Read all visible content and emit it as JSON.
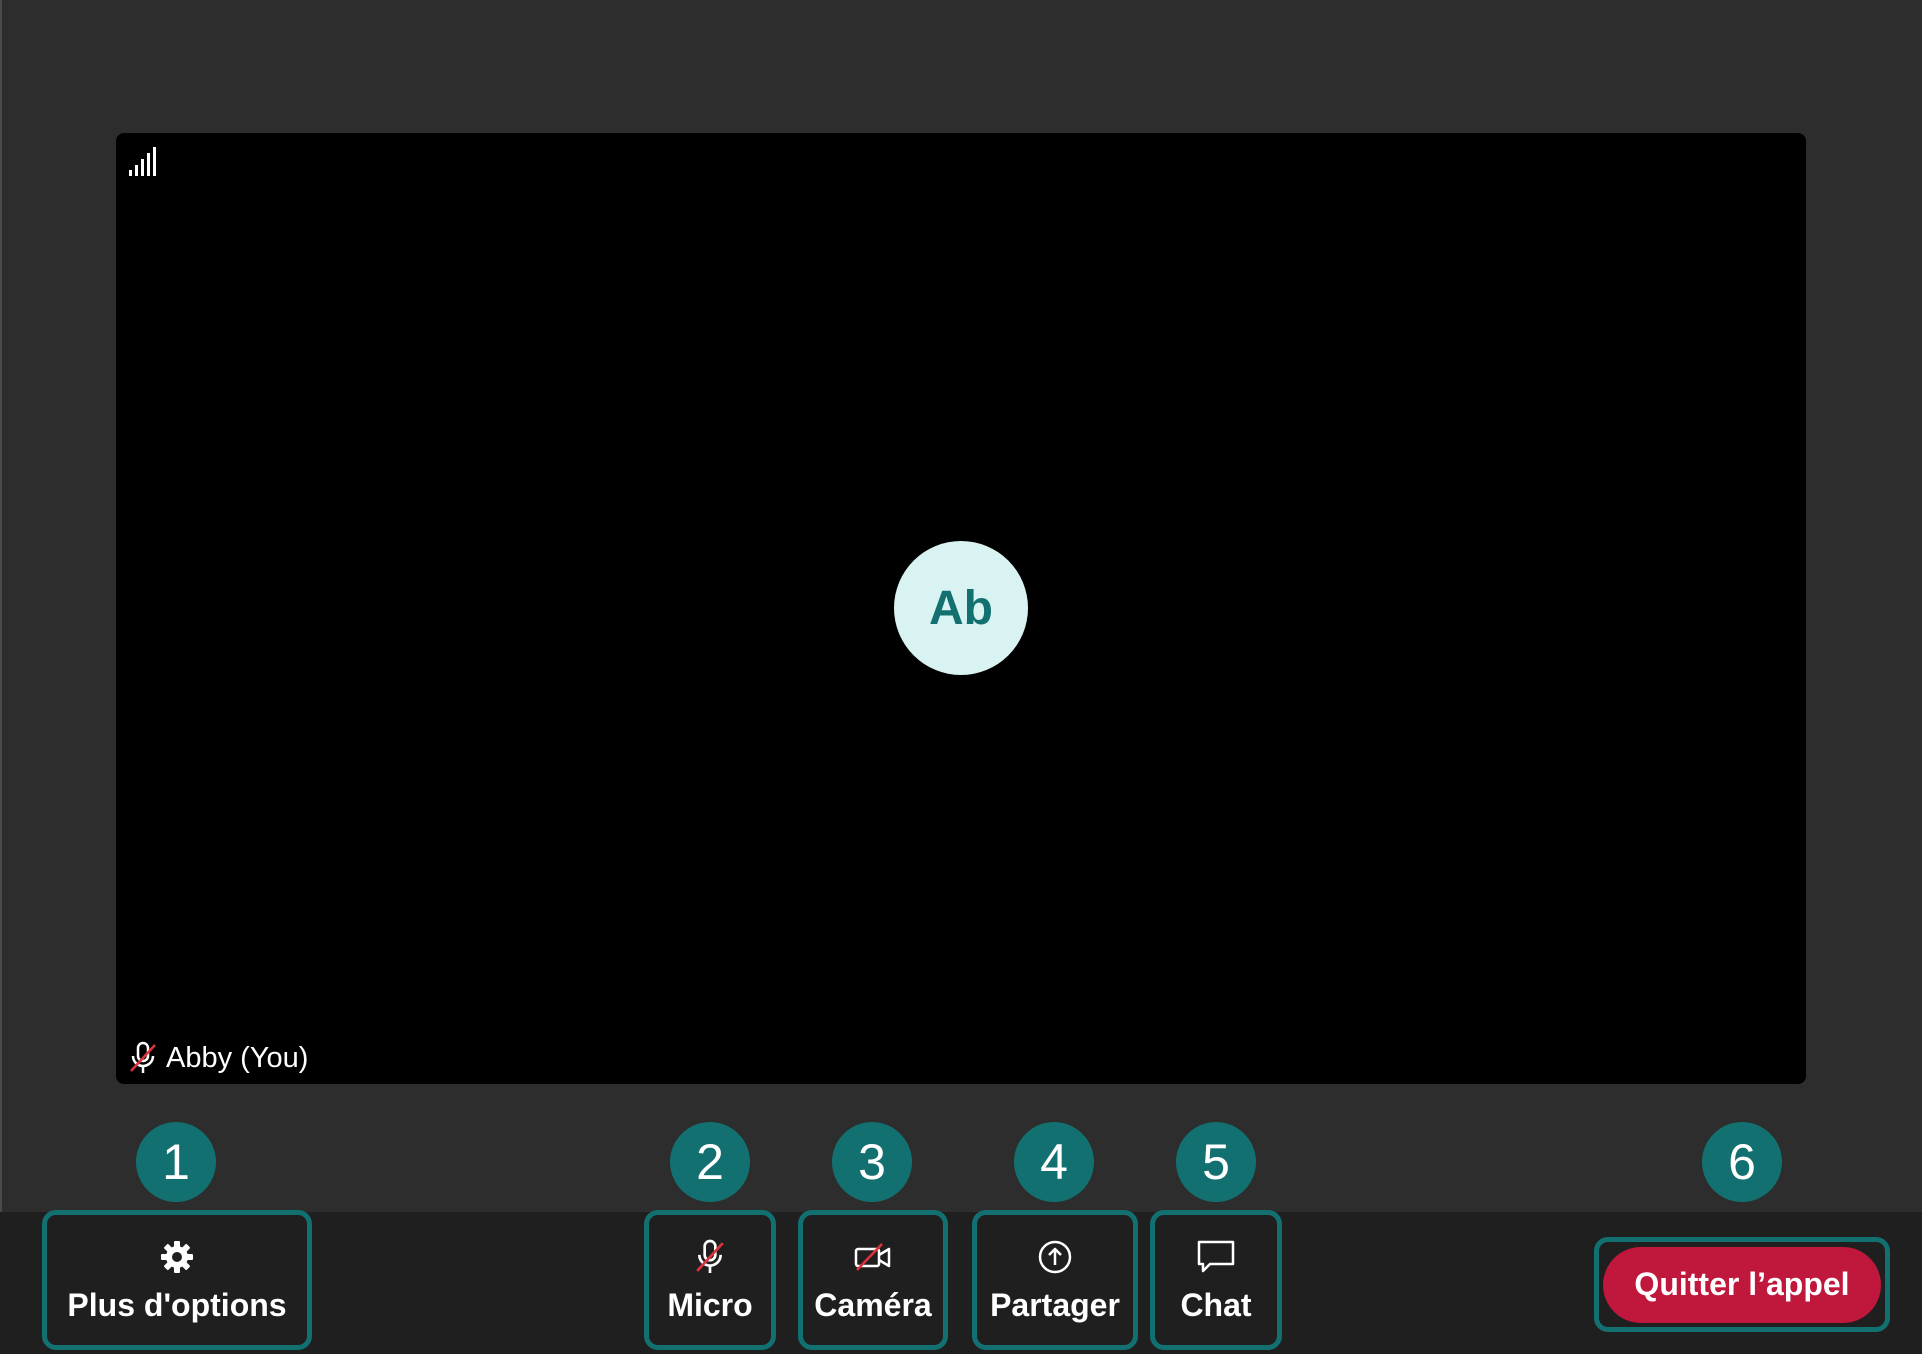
{
  "participant": {
    "initials": "Ab",
    "name": "Abby (You)"
  },
  "badges": [
    "1",
    "2",
    "3",
    "4",
    "5",
    "6"
  ],
  "toolbar": {
    "more_options_label": "Plus d'options",
    "micro_label": "Micro",
    "camera_label": "Caméra",
    "share_label": "Partager",
    "chat_label": "Chat",
    "leave_label": "Quitter l’appel"
  },
  "colors": {
    "accent": "#137070",
    "avatar_bg": "#d9f3f3",
    "leave": "#c0173d",
    "muted_slash": "#e0323c"
  },
  "icons": {
    "signal": "signal-strength-icon",
    "muted_mic": "microphone-muted-icon",
    "settings": "gear-icon",
    "camera_off": "camera-off-icon",
    "share": "upload-circle-icon",
    "chat": "chat-bubble-icon"
  }
}
